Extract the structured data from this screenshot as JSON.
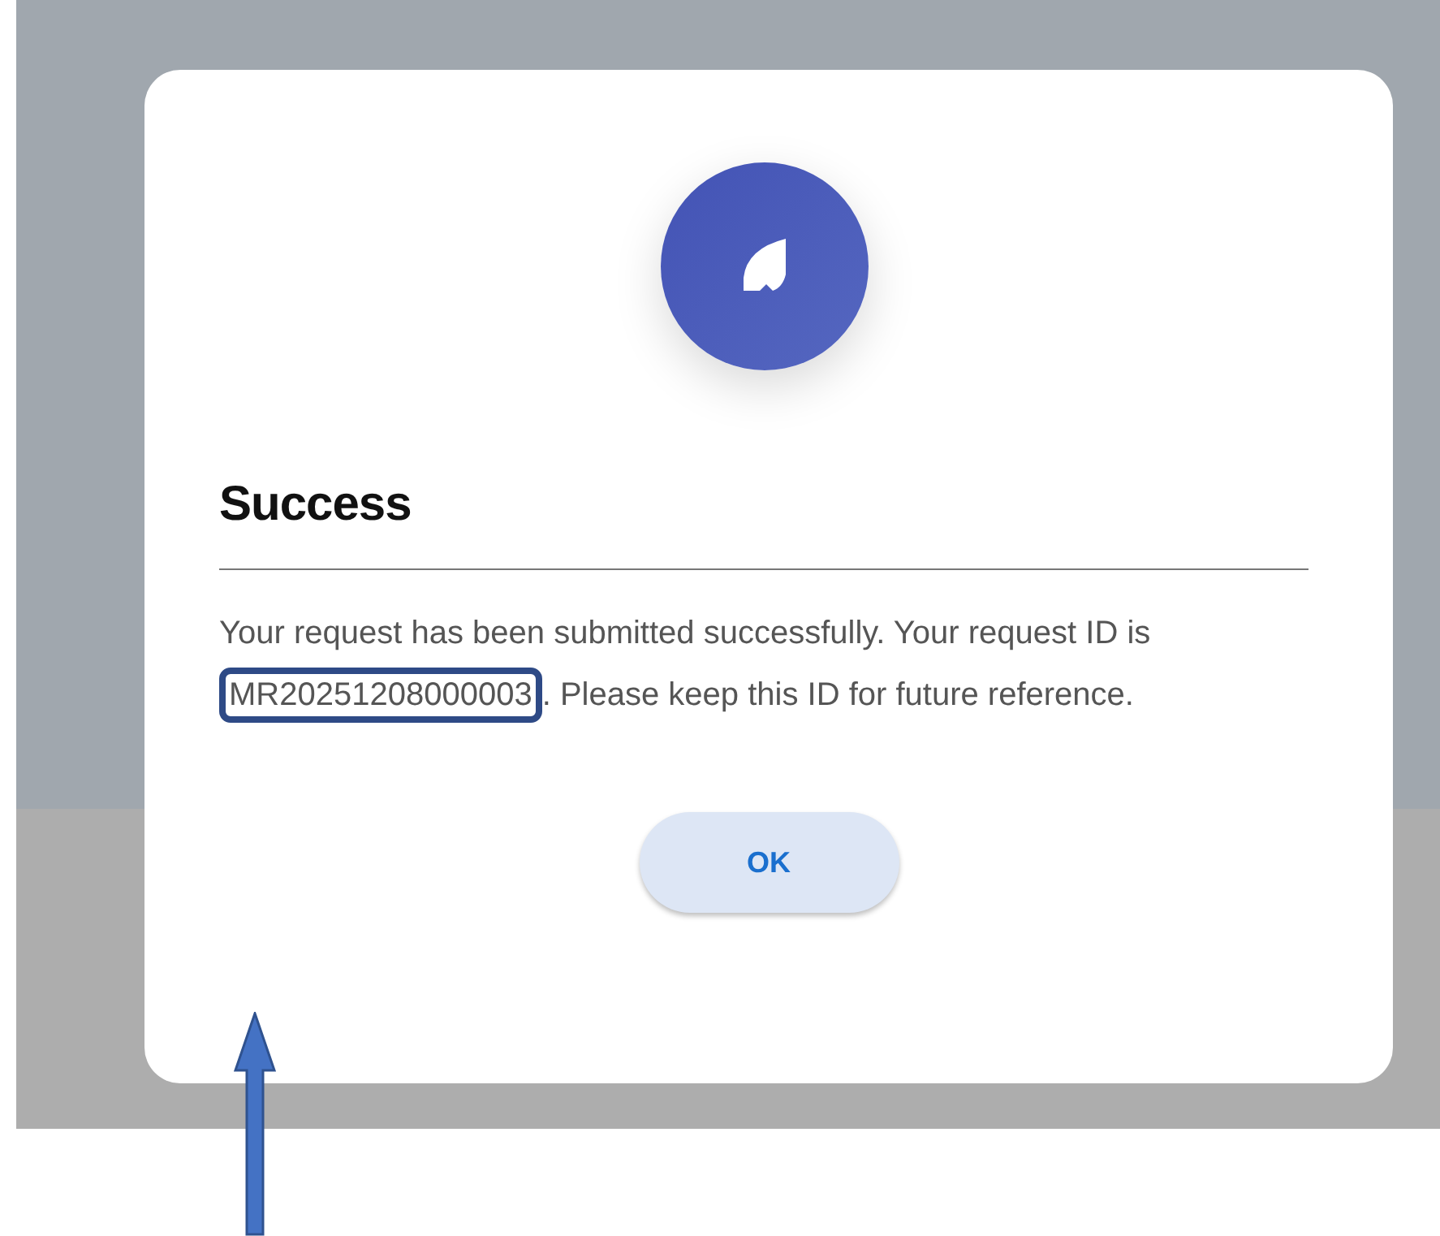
{
  "dialog": {
    "title": "Success",
    "message": [
      {
        "text": "Your request has been submitted successfully. Your request ID is ",
        "highlighted": false
      },
      {
        "text": "MR20251208000003",
        "highlighted": true
      },
      {
        "text": ". Please keep this ID for future reference.",
        "highlighted": false
      }
    ],
    "button": "OK"
  }
}
